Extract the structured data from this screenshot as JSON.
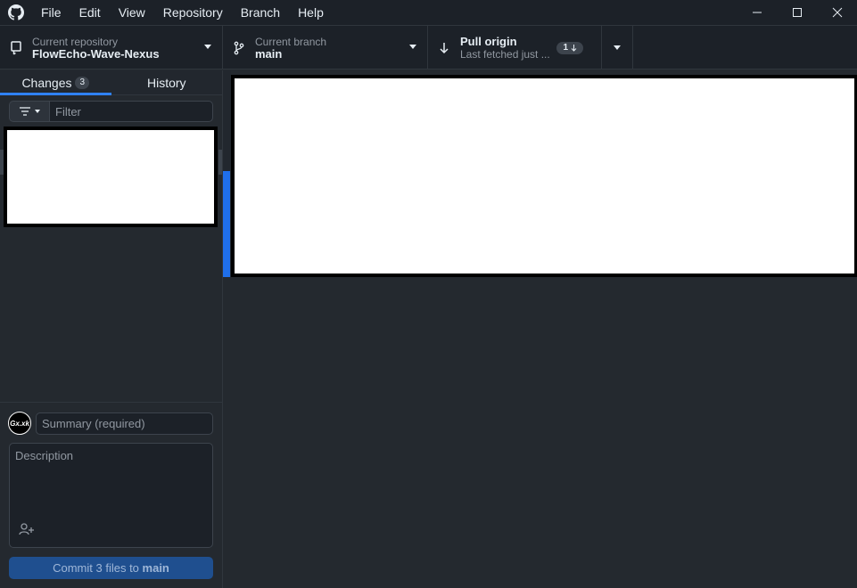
{
  "menu": {
    "items": [
      "File",
      "Edit",
      "View",
      "Repository",
      "Branch",
      "Help"
    ]
  },
  "toolbar": {
    "repo_label": "Current repository",
    "repo_value": "FlowEcho-Wave-Nexus",
    "branch_label": "Current branch",
    "branch_value": "main",
    "pull_label": "Pull origin",
    "pull_sub": "Last fetched just ...",
    "pull_count": "1"
  },
  "tabs": {
    "changes": "Changes",
    "changes_count": "3",
    "history": "History"
  },
  "filter": {
    "placeholder": "Filter"
  },
  "commit": {
    "avatar_text": "Gx.xk",
    "summary_placeholder": "Summary (required)",
    "description_placeholder": "Description",
    "button_prefix": "Commit 3 files to ",
    "button_branch": "main"
  },
  "colors": {
    "accent": "#2f81f7",
    "commit_button": "#1f4f8f"
  }
}
